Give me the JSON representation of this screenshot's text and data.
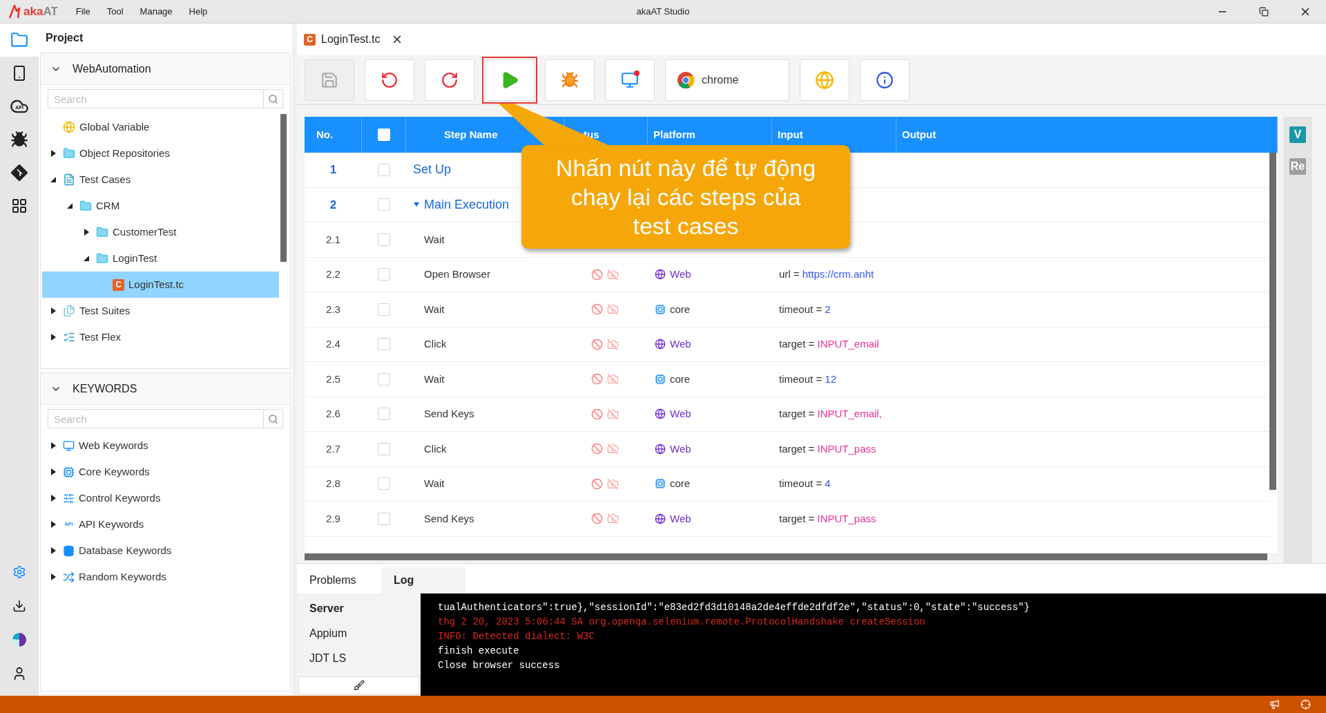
{
  "window": {
    "title": "akaAT Studio",
    "logo": [
      "aka",
      "AT"
    ]
  },
  "menu": [
    "File",
    "Tool",
    "Manage",
    "Help"
  ],
  "rail": {
    "top": [
      {
        "kind": "project",
        "selected": true
      },
      {
        "kind": "mobile",
        "selected": false
      },
      {
        "kind": "api",
        "badge": "API",
        "selected": false
      },
      {
        "kind": "debug",
        "selected": false
      },
      {
        "kind": "git",
        "selected": false
      },
      {
        "kind": "apps",
        "selected": false
      }
    ],
    "bottom": [
      {
        "kind": "settings"
      },
      {
        "kind": "download"
      },
      {
        "kind": "logo"
      },
      {
        "kind": "account"
      }
    ]
  },
  "sidebar": {
    "title": "Project",
    "project": {
      "name": "WebAutomation",
      "expanded": true,
      "search": {
        "placeholder": "Search"
      },
      "tree": [
        {
          "kind": "variable",
          "label": "Global Variable",
          "selected": false
        },
        {
          "kind": "repository",
          "label": "Object Repositories",
          "expanded": false,
          "selected": false
        },
        {
          "kind": "testcases",
          "label": "Test Cases",
          "expanded": true,
          "selected": false,
          "children": [
            {
              "kind": "folder",
              "label": "CRM",
              "expanded": true,
              "selected": false,
              "children": [
                {
                  "kind": "folder",
                  "label": "CustomerTest",
                  "expanded": false,
                  "selected": false
                },
                {
                  "kind": "folder",
                  "label": "LoginTest",
                  "expanded": true,
                  "selected": false,
                  "children": [
                    {
                      "kind": "file",
                      "badge": "C",
                      "label": "LoginTest.tc",
                      "selected": true
                    }
                  ]
                }
              ]
            }
          ]
        },
        {
          "kind": "suites",
          "label": "Test Suites",
          "expanded": false,
          "selected": false
        },
        {
          "kind": "flex",
          "label": "Test Flex",
          "expanded": false,
          "selected": false
        }
      ]
    },
    "keywords": {
      "name": "KEYWORDS",
      "expanded": true,
      "search": {
        "placeholder": "Search"
      },
      "items": [
        {
          "kind": "web",
          "label": "Web Keywords",
          "expanded": false,
          "selected": false
        },
        {
          "kind": "core",
          "label": "Core Keywords",
          "expanded": false,
          "selected": false
        },
        {
          "kind": "control",
          "label": "Control Keywords",
          "expanded": false,
          "selected": false
        },
        {
          "kind": "api",
          "badge": "API",
          "label": "API Keywords",
          "expanded": false,
          "selected": false
        },
        {
          "kind": "database",
          "label": "Database Keywords",
          "expanded": false,
          "selected": false
        },
        {
          "kind": "random",
          "label": "Random Keywords",
          "expanded": false,
          "selected": false
        }
      ]
    }
  },
  "editor": {
    "tabs": [
      {
        "label": "LoginTest.tc",
        "badge": "C",
        "selected": true
      }
    ],
    "toolbar": [
      {
        "kind": "save",
        "disabled": true,
        "highlighted": false
      },
      {
        "kind": "undo",
        "disabled": false,
        "highlighted": false
      },
      {
        "kind": "redo",
        "disabled": false,
        "highlighted": false
      },
      {
        "kind": "run",
        "disabled": false,
        "highlighted": true
      },
      {
        "kind": "debug",
        "disabled": false,
        "highlighted": false
      },
      {
        "kind": "remote",
        "disabled": false,
        "highlighted": false
      },
      {
        "kind": "browser",
        "label": "chrome",
        "disabled": false,
        "highlighted": false
      },
      {
        "kind": "web",
        "disabled": false,
        "highlighted": false
      },
      {
        "kind": "info",
        "disabled": false,
        "highlighted": false
      }
    ],
    "callout": {
      "lines": [
        "Nhấn nút này để tự động",
        "chạy lại các steps của",
        "test cases"
      ]
    },
    "table": {
      "columns": [
        {
          "kind": "text",
          "label": "No."
        },
        {
          "kind": "checkbox",
          "checked": false
        },
        {
          "kind": "text",
          "label": "Step Name"
        },
        {
          "kind": "text",
          "label": "tus"
        },
        {
          "kind": "text",
          "label": "Platform"
        },
        {
          "kind": "text",
          "label": "Input"
        },
        {
          "kind": "text",
          "label": "Output"
        }
      ],
      "rows": [
        {
          "kind": "section",
          "no": "1",
          "step": "Set Up",
          "checked": false
        },
        {
          "kind": "section",
          "no": "2",
          "step": "Main Execution",
          "checked": false,
          "expanded": true
        },
        {
          "kind": "step",
          "no": "2.1",
          "step": "Wait",
          "checked": false
        },
        {
          "kind": "step",
          "no": "2.2",
          "step": "Open Browser",
          "checked": false,
          "platform": {
            "kind": "web",
            "label": "Web"
          },
          "input": {
            "key": "url",
            "op": "=",
            "value": "https://crm.anht",
            "kind": "url"
          }
        },
        {
          "kind": "step",
          "no": "2.3",
          "step": "Wait",
          "checked": false,
          "platform": {
            "kind": "core",
            "label": "core"
          },
          "input": {
            "key": "timeout",
            "op": "=",
            "value": "2",
            "kind": "number"
          }
        },
        {
          "kind": "step",
          "no": "2.4",
          "step": "Click",
          "checked": false,
          "platform": {
            "kind": "web",
            "label": "Web"
          },
          "input": {
            "key": "target",
            "op": "=",
            "value": "INPUT_email",
            "kind": "object"
          }
        },
        {
          "kind": "step",
          "no": "2.5",
          "step": "Wait",
          "checked": false,
          "platform": {
            "kind": "core",
            "label": "core"
          },
          "input": {
            "key": "timeout",
            "op": "=",
            "value": "12",
            "kind": "number"
          }
        },
        {
          "kind": "step",
          "no": "2.6",
          "step": "Send Keys",
          "checked": false,
          "platform": {
            "kind": "web",
            "label": "Web"
          },
          "input": {
            "key": "target",
            "op": "=",
            "value": "INPUT_email,",
            "kind": "object"
          }
        },
        {
          "kind": "step",
          "no": "2.7",
          "step": "Click",
          "checked": false,
          "platform": {
            "kind": "web",
            "label": "Web"
          },
          "input": {
            "key": "target",
            "op": "=",
            "value": "INPUT_pass",
            "kind": "object"
          }
        },
        {
          "kind": "step",
          "no": "2.8",
          "step": "Wait",
          "checked": false,
          "platform": {
            "kind": "core",
            "label": "core"
          },
          "input": {
            "key": "timeout",
            "op": "=",
            "value": "4",
            "kind": "number"
          }
        },
        {
          "kind": "step",
          "no": "2.9",
          "step": "Send Keys",
          "checked": false,
          "platform": {
            "kind": "web",
            "label": "Web"
          },
          "input": {
            "key": "target",
            "op": "=",
            "value": "INPUT_pass",
            "kind": "object"
          }
        }
      ]
    },
    "side_badges": [
      {
        "label": "V",
        "color": "#1b98a8"
      },
      {
        "label": "Re",
        "color": "#9e9e9e"
      }
    ]
  },
  "bottom_panel": {
    "tabs": [
      {
        "label": "Problems",
        "selected": false
      },
      {
        "label": "Log",
        "selected": true
      }
    ],
    "servers": [
      {
        "label": "Server",
        "selected": true
      },
      {
        "label": "Appium",
        "selected": false
      },
      {
        "label": "JDT LS",
        "selected": false
      }
    ],
    "log": [
      {
        "kind": "info",
        "text": "tualAuthenticators\":true},\"sessionId\":\"e83ed2fd3d10148a2de4effde2dfdf2e\",\"status\":0,\"state\":\"success\"}"
      },
      {
        "kind": "error",
        "text": "thg 2 20, 2023 5:06:44 SA org.openqa.selenium.remote.ProtocolHandshake createSession"
      },
      {
        "kind": "error",
        "text": "INFO: Detected dialect: W3C"
      },
      {
        "kind": "info",
        "text": "finish execute"
      },
      {
        "kind": "info",
        "text": "Close browser success"
      }
    ]
  }
}
